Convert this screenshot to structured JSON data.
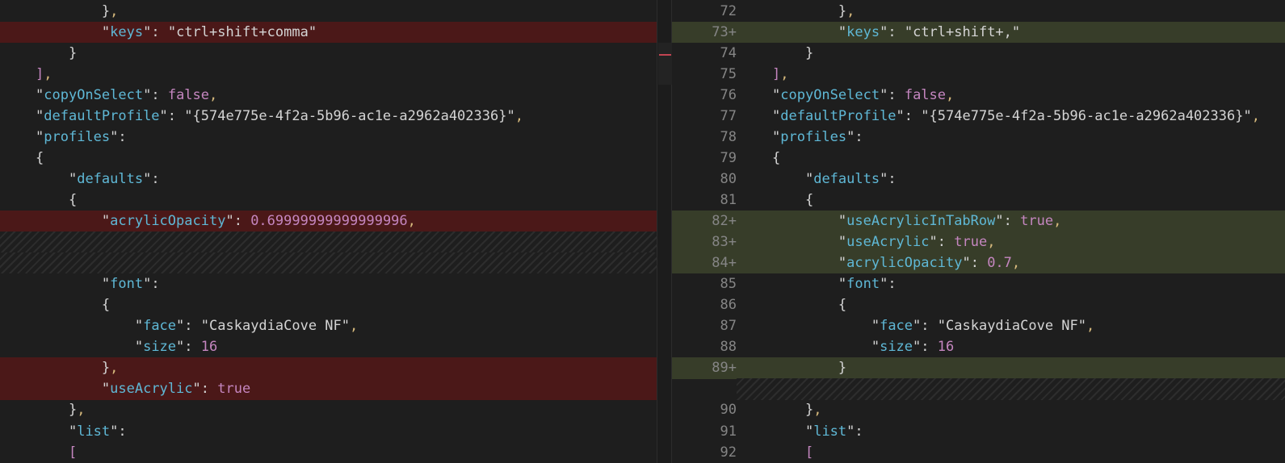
{
  "left": {
    "lines": [
      {
        "text": "        },",
        "kind": "normal"
      },
      {
        "text": "        \"keys\": \"ctrl+shift+comma\"",
        "kind": "del"
      },
      {
        "text": "    }",
        "kind": "normal"
      },
      {
        "text": "],",
        "kind": "normal"
      },
      {
        "text": "\"copyOnSelect\": false,",
        "kind": "normal"
      },
      {
        "text": "\"defaultProfile\": \"{574e775e-4f2a-5b96-ac1e-a2962a402336}\",",
        "kind": "normal"
      },
      {
        "text": "\"profiles\":",
        "kind": "normal"
      },
      {
        "text": "{",
        "kind": "normal"
      },
      {
        "text": "    \"defaults\":",
        "kind": "normal"
      },
      {
        "text": "    {",
        "kind": "normal"
      },
      {
        "text": "        \"acrylicOpacity\": 0.69999999999999996,",
        "kind": "del"
      },
      {
        "text": "",
        "kind": "hatch"
      },
      {
        "text": "",
        "kind": "hatch"
      },
      {
        "text": "        \"font\":",
        "kind": "normal"
      },
      {
        "text": "        {",
        "kind": "normal"
      },
      {
        "text": "            \"face\": \"CaskaydiaCove NF\",",
        "kind": "normal"
      },
      {
        "text": "            \"size\": 16",
        "kind": "normal"
      },
      {
        "text": "        },",
        "kind": "del"
      },
      {
        "text": "        \"useAcrylic\": true",
        "kind": "del"
      },
      {
        "text": "    },",
        "kind": "normal"
      },
      {
        "text": "    \"list\":",
        "kind": "normal"
      },
      {
        "text": "    [",
        "kind": "normal"
      }
    ]
  },
  "right": {
    "lines": [
      {
        "num": "72",
        "text": "        },",
        "kind": "normal"
      },
      {
        "num": "73+",
        "text": "        \"keys\": \"ctrl+shift+,\"",
        "kind": "add"
      },
      {
        "num": "74",
        "text": "    }",
        "kind": "normal"
      },
      {
        "num": "75",
        "text": "],",
        "kind": "normal"
      },
      {
        "num": "76",
        "text": "\"copyOnSelect\": false,",
        "kind": "normal"
      },
      {
        "num": "77",
        "text": "\"defaultProfile\": \"{574e775e-4f2a-5b96-ac1e-a2962a402336}\",",
        "kind": "normal"
      },
      {
        "num": "78",
        "text": "\"profiles\":",
        "kind": "normal"
      },
      {
        "num": "79",
        "text": "{",
        "kind": "normal"
      },
      {
        "num": "80",
        "text": "    \"defaults\":",
        "kind": "normal"
      },
      {
        "num": "81",
        "text": "    {",
        "kind": "normal"
      },
      {
        "num": "82+",
        "text": "        \"useAcrylicInTabRow\": true,",
        "kind": "add"
      },
      {
        "num": "83+",
        "text": "        \"useAcrylic\": true,",
        "kind": "add"
      },
      {
        "num": "84+",
        "text": "        \"acrylicOpacity\": 0.7,",
        "kind": "add"
      },
      {
        "num": "85",
        "text": "        \"font\":",
        "kind": "normal"
      },
      {
        "num": "86",
        "text": "        {",
        "kind": "normal"
      },
      {
        "num": "87",
        "text": "            \"face\": \"CaskaydiaCove NF\",",
        "kind": "normal"
      },
      {
        "num": "88",
        "text": "            \"size\": 16",
        "kind": "normal"
      },
      {
        "num": "89+",
        "text": "        }",
        "kind": "add"
      },
      {
        "num": "",
        "text": "",
        "kind": "hatch"
      },
      {
        "num": "90",
        "text": "    },",
        "kind": "normal"
      },
      {
        "num": "91",
        "text": "    \"list\":",
        "kind": "normal"
      },
      {
        "num": "92",
        "text": "    [",
        "kind": "normal"
      }
    ]
  },
  "colors": {
    "background": "#1e1e1e",
    "deleted_line": "#4b1818",
    "added_line": "#373d29",
    "deleted_char": "#6f1313",
    "added_char": "#4b5632",
    "key": "#5fb8d6",
    "boolean": "#c586c0",
    "number": "#c586c0",
    "brace": "#ffd700"
  }
}
